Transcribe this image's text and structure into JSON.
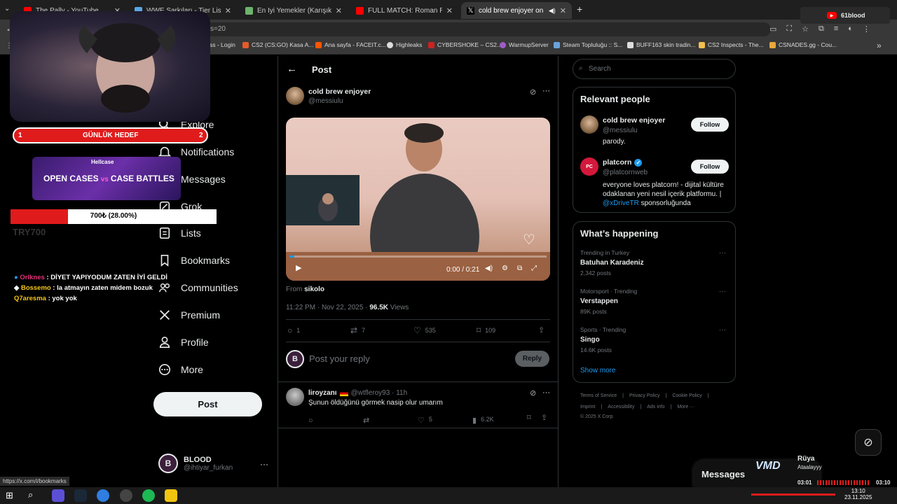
{
  "colors": {
    "accent": "#1d9bf0",
    "bg": "#000000",
    "text": "#e7e9ea",
    "muted": "#71767b",
    "stream_red": "#e01b1b",
    "youtube_red": "#ff0000"
  },
  "browser": {
    "tabs": [
      {
        "title": "The Pally - YouTube",
        "icon": "youtube-icon"
      },
      {
        "title": "WWE Sarkıları - Tier List, Kör Sı",
        "icon": "globe-icon"
      },
      {
        "title": "En İyi Yemekler (Karışık) - Tier L",
        "icon": "globe-icon"
      },
      {
        "title": "FULL MATCH: Roman Reigns vs",
        "icon": "youtube-icon"
      },
      {
        "title": "cold brew enjoyer on X: \"@",
        "icon": "x-icon"
      }
    ],
    "new_tab": "+",
    "url_fragment": "s=20",
    "bookmarks": [
      "ss - Login",
      "CS2 (CS:GO) Kasa A...",
      "Ana sayfa - FACEIT.c...",
      "Highleaks",
      "CYBERSHOKE – CS2...",
      "WarmupServer",
      "Steam Topluluğu :: S...",
      "BUFF163 skin tradin...",
      "CS2 Inspects - The...",
      "CSNADES.gg - Cou..."
    ],
    "more_bookmarks": "»",
    "status_url": "https://x.com/i/bookmarks"
  },
  "nav": {
    "items": [
      {
        "label": "Explore",
        "icon": "search-icon"
      },
      {
        "label": "Notifications",
        "icon": "bell-icon"
      },
      {
        "label": "Messages",
        "icon": "mail-icon"
      },
      {
        "label": "Grok",
        "icon": "grok-icon"
      },
      {
        "label": "Lists",
        "icon": "list-icon"
      },
      {
        "label": "Bookmarks",
        "icon": "bookmark-icon"
      },
      {
        "label": "Communities",
        "icon": "people-icon"
      },
      {
        "label": "Premium",
        "icon": "x-logo-icon"
      },
      {
        "label": "Profile",
        "icon": "person-icon"
      },
      {
        "label": "More",
        "icon": "more-circle-icon"
      }
    ],
    "post_button": "Post",
    "account": {
      "name": "BLOOD",
      "handle": "@ihtiyar_furkan",
      "more": "···"
    }
  },
  "post": {
    "header_title": "Post",
    "back": "←",
    "author": "cold brew enjoyer",
    "handle": "@messiulu",
    "more": "···",
    "video": {
      "time": "0:00 / 0:21",
      "progress": 0.02
    },
    "from_label": "From",
    "from_name": "sikolo",
    "timestamp": "11:22 PM · Nov 22, 2025 ·",
    "views": "96.5K",
    "views_label": "Views",
    "stats": {
      "replies": "1",
      "reposts": "7",
      "likes": "535",
      "bookmarks": "109"
    },
    "reply_placeholder": "Post your reply",
    "reply_button": "Reply"
  },
  "reply": {
    "name": "liroyzanı",
    "handle": "@wtfleroy93 · 11h",
    "text": "Şunun öldüğünü görmek nasip olur umarım",
    "stats": {
      "reposts": "",
      "likes": "5",
      "views": "6.2K"
    }
  },
  "sidebar": {
    "search_placeholder": "Search",
    "relevant_title": "Relevant people",
    "people": [
      {
        "name": "cold brew enjoyer",
        "handle": "@messiulu",
        "bio": "parody.",
        "follow": "Follow",
        "verified": false
      },
      {
        "name": "platcorn",
        "handle": "@platcornweb",
        "bio": "everyone loves platcorn! - dijital kültüre odaklanan yeni nesil içerik platformu. |",
        "bio_link": "@xDriveTR",
        "bio_suffix": " sponsorluğunda",
        "follow": "Follow",
        "verified": true
      }
    ],
    "happening_title": "What’s happening",
    "trends": [
      {
        "context": "Trending in Turkey",
        "name": "Batuhan Karadeniz",
        "count": "2,342 posts"
      },
      {
        "context": "Motorsport · Trending",
        "name": "Verstappen",
        "count": "89K posts"
      },
      {
        "context": "Sports · Trending",
        "name": "Singo",
        "count": "14.6K posts"
      }
    ],
    "show_more": "Show more",
    "footer_row1": [
      "Terms of Service",
      "|",
      "Privacy Policy",
      "|",
      "Cookie Policy",
      "|"
    ],
    "footer_row2": [
      "Imprint",
      "|",
      "Accessibility",
      "|",
      "Ads info",
      "|",
      "More ···"
    ],
    "copyright": "© 2025 X Corp."
  },
  "messages_drawer": {
    "label": "Messages"
  },
  "stream": {
    "goal": {
      "start": "1",
      "title": "GÜNLÜK HEDEF",
      "end": "2"
    },
    "promo": {
      "brand": "Hellcase",
      "line1": "OPEN CASES",
      "vs": "vs",
      "line2": "CASE BATTLES"
    },
    "donation_bar": {
      "text": "700₺ (28.00%)",
      "progress": 0.28
    },
    "ghost_text": "TRY700",
    "chat": [
      {
        "user": "Orlknes",
        "msg": " : DİYET YAPIYODUM ZATEN İYİ GELDİ",
        "color": "#e5317a"
      },
      {
        "user": "Bossemo",
        "msg": " : la atmayın zaten midem bozuk",
        "color": "#f5c518"
      },
      {
        "user": "Q7aresma",
        "msg": " : yok yok",
        "color": "#f5c518"
      }
    ],
    "youtube_badge": "61blood",
    "music": {
      "title": "Rüya",
      "artist": "Ataalayyy",
      "elapsed": "03:01",
      "total": "03:10"
    }
  },
  "taskbar": {
    "time": "13:10",
    "date": "23.11.2025"
  }
}
